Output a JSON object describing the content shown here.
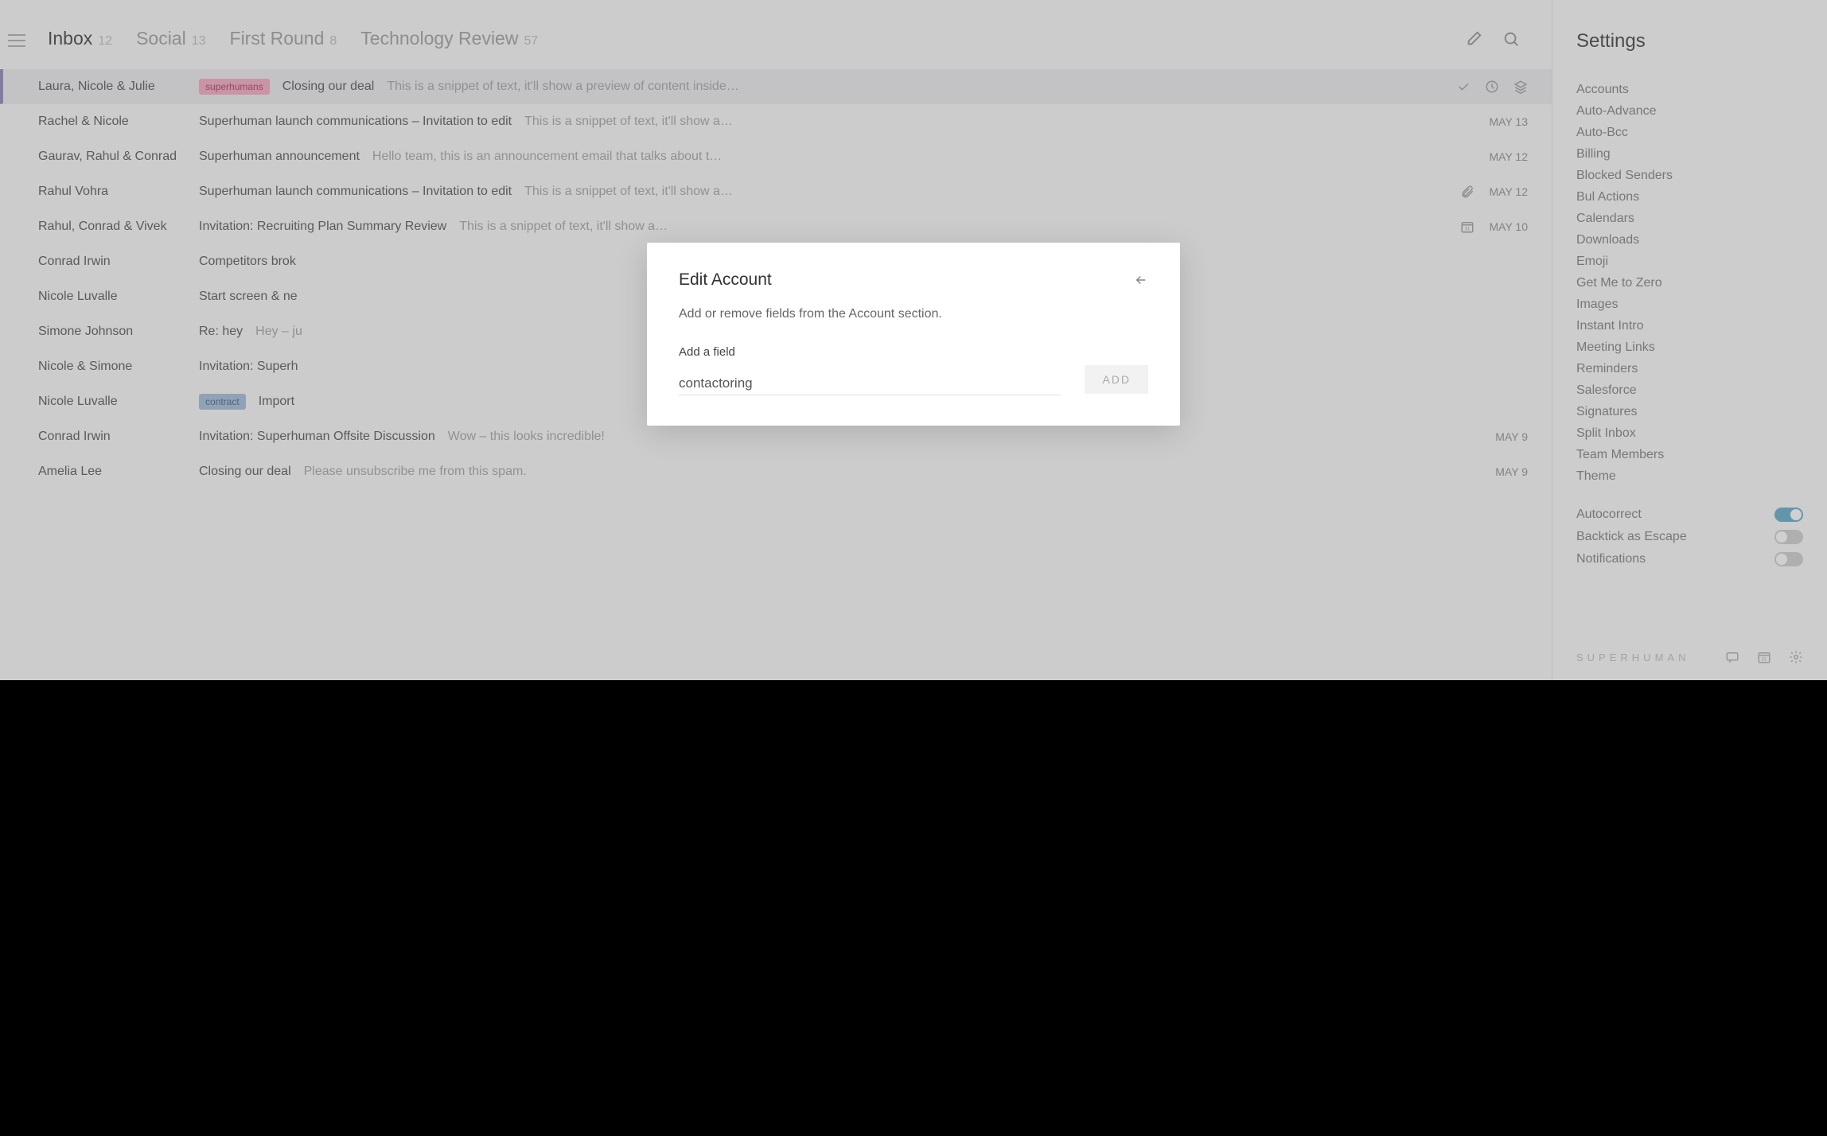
{
  "tabs": [
    {
      "label": "Inbox",
      "count": "12",
      "active": true
    },
    {
      "label": "Social",
      "count": "13",
      "active": false
    },
    {
      "label": "First Round",
      "count": "8",
      "active": false
    },
    {
      "label": "Technology Review",
      "count": "57",
      "active": false
    }
  ],
  "emails": [
    {
      "sender": "Laura, Nicole & Julie",
      "tag": "superhumans",
      "tagColor": "pink",
      "subject": "Closing our deal",
      "snippet": "This is a snippet of text, it'll show a preview of content inside…",
      "date": "",
      "selected": true,
      "icons": [
        "check",
        "clock",
        "stack"
      ]
    },
    {
      "sender": "Rachel & Nicole",
      "subject": "Superhuman launch communications – Invitation to edit",
      "snippet": "This is a snippet of text, it'll show a…",
      "date": "MAY 13"
    },
    {
      "sender": "Gaurav, Rahul & Conrad",
      "subject": "Superhuman announcement",
      "snippet": "Hello team, this is an announcement email that talks about t…",
      "date": "MAY 12"
    },
    {
      "sender": "Rahul Vohra",
      "subject": "Superhuman launch communications – Invitation to edit",
      "snippet": "This is a snippet of text, it'll show a…",
      "date": "MAY 12",
      "icons": [
        "attach"
      ]
    },
    {
      "sender": "Rahul, Conrad & Vivek",
      "subject": "Invitation: Recruiting Plan Summary Review",
      "snippet": "This is a snippet of text, it'll show a…",
      "date": "MAY 10",
      "icons": [
        "calendar"
      ]
    },
    {
      "sender": "Conrad Irwin",
      "subject": "Competitors brok",
      "snippet": "",
      "date": ""
    },
    {
      "sender": "Nicole Luvalle",
      "subject": "Start screen & ne",
      "snippet": "",
      "date": ""
    },
    {
      "sender": "Simone Johnson",
      "subject": "Re: hey",
      "snippet": "Hey – ju",
      "date": ""
    },
    {
      "sender": "Nicole & Simone",
      "subject": "Invitation: Superh",
      "snippet": "",
      "date": ""
    },
    {
      "sender": "Nicole Luvalle",
      "tag": "contract",
      "tagColor": "blue",
      "subject": "Import",
      "snippet": "",
      "date": ""
    },
    {
      "sender": "Conrad Irwin",
      "subject": "Invitation: Superhuman Offsite Discussion",
      "snippet": "Wow – this looks incredible!",
      "date": "MAY 9"
    },
    {
      "sender": "Amelia Lee",
      "subject": "Closing our deal",
      "snippet": "Please unsubscribe me from this spam.",
      "date": "MAY 9"
    }
  ],
  "settings": {
    "title": "Settings",
    "links": [
      "Accounts",
      "Auto-Advance",
      "Auto-Bcc",
      "Billing",
      "Blocked Senders",
      "Bul Actions",
      "Calendars",
      "Downloads",
      "Emoji",
      "Get Me to Zero",
      "Images",
      "Instant Intro",
      "Meeting Links",
      "Reminders",
      "Salesforce",
      "Signatures",
      "Split Inbox",
      "Team Members",
      "Theme"
    ],
    "toggles": [
      {
        "label": "Autocorrect",
        "on": true
      },
      {
        "label": "Backtick as Escape",
        "on": false
      },
      {
        "label": "Notifications",
        "on": false
      }
    ],
    "brand": "SUPERHUMAN"
  },
  "modal": {
    "title": "Edit Account",
    "description": "Add or remove fields from the Account section.",
    "fieldLabel": "Add a field",
    "fieldValue": "contactoring",
    "addButton": "ADD"
  }
}
